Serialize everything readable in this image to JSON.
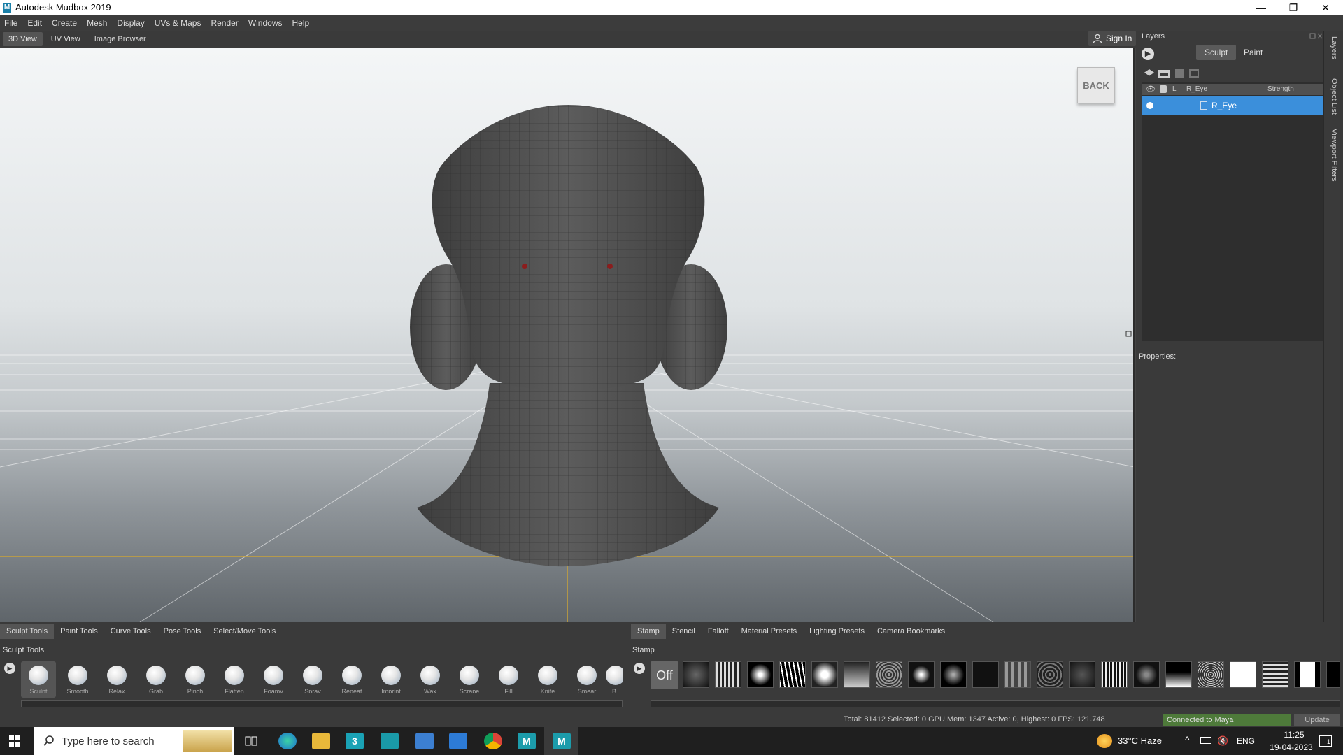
{
  "window": {
    "app_icon": "M",
    "title": "Autodesk Mudbox 2019",
    "minimize": "—",
    "restore": "❐",
    "close": "✕"
  },
  "menu": [
    "File",
    "Edit",
    "Create",
    "Mesh",
    "Display",
    "UVs & Maps",
    "Render",
    "Windows",
    "Help"
  ],
  "view_tabs": [
    "3D View",
    "UV View",
    "Image Browser"
  ],
  "sign_in": "Sign In",
  "viewcube_label": "BACK",
  "layers_panel": {
    "title": "Layers",
    "sculpt_btn": "Sculpt",
    "paint_btn": "Paint",
    "columns": {
      "lock": "L",
      "name": "R_Eye",
      "strength": "Strength"
    },
    "layer_name": "R_Eye",
    "properties_label": "Properties:"
  },
  "side_tabs": [
    "Layers",
    "Object List",
    "Viewport Filters"
  ],
  "tool_tabs": [
    "Sculpt Tools",
    "Paint Tools",
    "Curve Tools",
    "Pose Tools",
    "Select/Move Tools"
  ],
  "tool_section_title": "Sculpt Tools",
  "tools": [
    "Sculpt",
    "Smooth",
    "Relax",
    "Grab",
    "Pinch",
    "Flatten",
    "Foamy",
    "Spray",
    "Repeat",
    "Imprint",
    "Wax",
    "Scrape",
    "Fill",
    "Knife",
    "Smear",
    "B"
  ],
  "stamp_tabs": [
    "Stamp",
    "Stencil",
    "Falloff",
    "Material Presets",
    "Lighting Presets",
    "Camera Bookmarks"
  ],
  "stamp_section_title": "Stamp",
  "stamp_off": "Off",
  "status": {
    "stats": "Total: 81412  Selected: 0 GPU Mem: 1347  Active: 0, Highest: 0  FPS: 121.748",
    "connection": "Connected to Maya",
    "update": "Update"
  },
  "taskbar": {
    "search_placeholder": "Type here to search",
    "weather": "33°C  Haze",
    "language": "ENG",
    "time": "11:25",
    "date": "19-04-2023",
    "notifications": "1"
  }
}
